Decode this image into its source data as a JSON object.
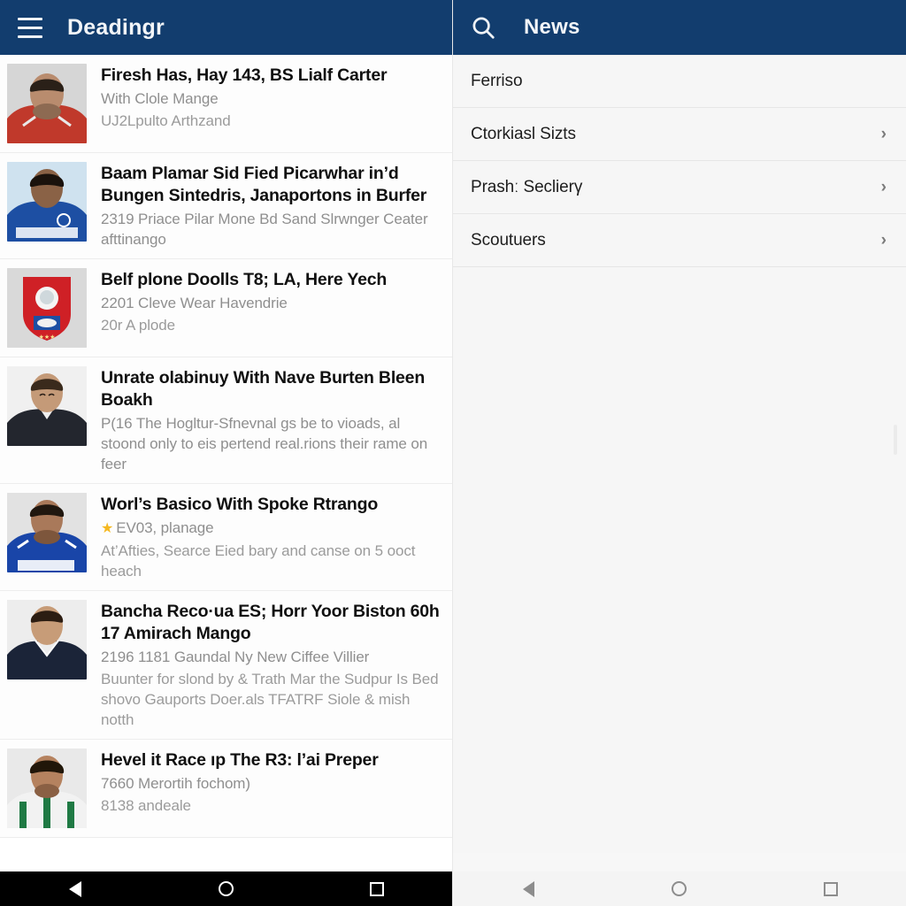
{
  "left_panel": {
    "appbar": {
      "menu_icon": "hamburger-menu-icon",
      "title": "Deadingr"
    },
    "news_items": [
      {
        "title": "Firesh Has, Hay 143, BS Lialf Carter",
        "sub1": "With Clole Mange",
        "sub2": "UJ2Lpulto Arthzand",
        "has_star": false,
        "thumb": "player-red-kit-photo"
      },
      {
        "title": "Baam Plamar Sid Fied Picarwhar in’d Bungen Sintedris, Janaportons in Burfer",
        "sub1": "2319 Priace Pilar Mone Bd Sand Slrwnger Ceater afttinango",
        "sub2": "",
        "has_star": false,
        "thumb": "player-blue-kit-photo"
      },
      {
        "title": "Belf plone Doolls T8; LA, Here Yech",
        "sub1": "2201 Cleve Wear Havendrie",
        "sub2": "20r A plode",
        "has_star": false,
        "thumb": "club-crest-badge"
      },
      {
        "title": "Unrate olabinuy With Nave Burten Bleen Boakh",
        "sub1": "P(16 The Hogltur-Sfnevnal gs be to vioads, al stoond only to eis pertend real.rions their rame on feer",
        "sub2": "",
        "has_star": false,
        "thumb": "player-dark-polo-photo"
      },
      {
        "title": "Worl’s Basico With Spoke Rtrango",
        "sub1": "EV03, planage",
        "sub2": "At’Afties, Searce Eied bary and canse on 5 ooct heach",
        "has_star": true,
        "thumb": "player-blue-jersey-photo"
      },
      {
        "title": "Bancha Reco·ua ES; Horr Yoor Biston 60h 17 Amirach Mango",
        "sub1": "2196 1181 Gaundal Ny New Ciffee Villier",
        "sub2": "Buunter for slond by & Trath Mar the Sudpur Is Bed shovo Gauports Doer.als TFATRF Siole & mish notth",
        "has_star": false,
        "thumb": "player-navy-vneck-photo"
      },
      {
        "title": "Hevel it Race ıp The R3: l’ai Preper",
        "sub1": "7660 Merortih fochom)",
        "sub2": "8138 andeale",
        "has_star": false,
        "thumb": "player-green-stripe-photo"
      }
    ],
    "navbar": {
      "back": "back-triangle-icon",
      "home": "home-circle-icon",
      "recents": "recents-square-icon"
    }
  },
  "right_panel": {
    "appbar": {
      "search_icon": "search-icon",
      "title": "News"
    },
    "settings_rows": [
      {
        "label": "Ferriso",
        "chevron": ""
      },
      {
        "label": "Ctorkiasl Sizts",
        "chevron": "›"
      },
      {
        "label": "Prashː Seclierγ",
        "chevron": "›"
      },
      {
        "label": "Scoutuers",
        "chevron": "›"
      }
    ],
    "navbar": {
      "back": "back-triangle-icon",
      "home": "home-circle-icon",
      "recents": "recents-square-icon"
    }
  },
  "colors": {
    "appbar": "#123d6e",
    "star": "#f5b820",
    "navbar_dark": "#000000",
    "navbar_light": "#f4f4f4"
  }
}
